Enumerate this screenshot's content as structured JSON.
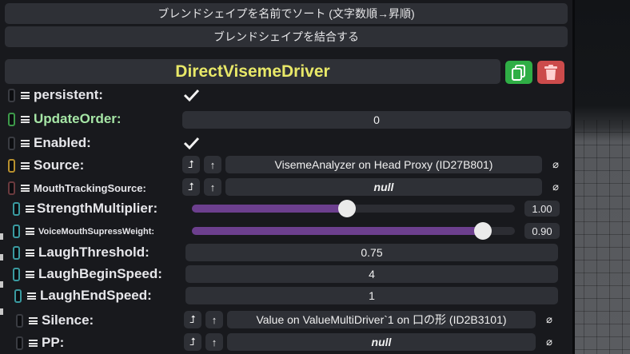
{
  "buttons": {
    "sort_label": "ブレンドシェイプを名前でソート (文字数順→昇順)",
    "merge_label": "ブレンドシェイプを結合する"
  },
  "component": {
    "title": "DirectVisemeDriver"
  },
  "fields": {
    "persistent": {
      "label": "persistent:",
      "checked": true
    },
    "update_order": {
      "label": "UpdateOrder:",
      "value": "0"
    },
    "enabled": {
      "label": "Enabled:",
      "checked": true
    },
    "source": {
      "label": "Source:",
      "value": "VisemeAnalyzer on Head Proxy (ID27B801)"
    },
    "mouth_tracking_source": {
      "label": "MouthTrackingSource:",
      "value": "null"
    },
    "strength_multiplier": {
      "label": "StrengthMultiplier:",
      "value": "1.00",
      "fraction": 0.48
    },
    "voice_mouth_supress_weight": {
      "label": "VoiceMouthSupressWeight:",
      "value": "0.90",
      "fraction": 0.9
    },
    "laugh_threshold": {
      "label": "LaughThreshold:",
      "value": "0.75"
    },
    "laugh_begin_speed": {
      "label": "LaughBeginSpeed:",
      "value": "4"
    },
    "laugh_end_speed": {
      "label": "LaughEndSpeed:",
      "value": "1"
    },
    "silence": {
      "label": "Silence:",
      "value": "Value on ValueMultiDriver`1 on 口の形 (ID2B3101)"
    },
    "pp": {
      "label": "PP:",
      "value": "null"
    }
  },
  "colors": {
    "accent": "#e8e868",
    "slider_fill": "#6c3f8e",
    "copy_button": "#2fae45",
    "delete_button": "#cc4b4b"
  },
  "icons": {
    "copy": "duplicate-icon",
    "delete": "trash-icon",
    "clear": "null-slash-icon",
    "up": "arrow-up-icon",
    "jump": "jump-arrow-icon"
  }
}
